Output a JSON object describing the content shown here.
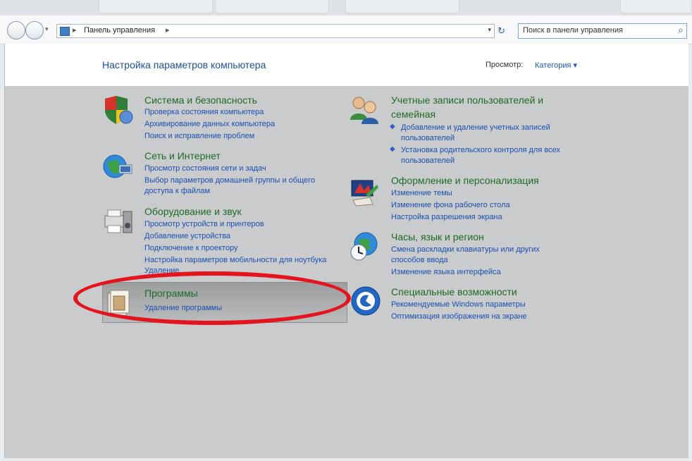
{
  "window": {
    "title": "Панель управления"
  },
  "address": {
    "breadcrumb": "Панель управления",
    "separator": "▸",
    "search_placeholder": "Поиск в панели управления"
  },
  "header": {
    "title": "Настройка параметров компьютера",
    "view_by_label": "Просмотр:",
    "view_by_value": "Категория ▾"
  },
  "categories_left": [
    {
      "title": "Система и безопасность",
      "icon": "shield-flag-icon",
      "links": [
        "Проверка состояния компьютера",
        "Архивирование данных компьютера",
        "Поиск и исправление проблем"
      ]
    },
    {
      "title": "Сеть и Интернет",
      "icon": "globe-network-icon",
      "links": [
        "Просмотр состояния сети и задач",
        "Выбор параметров домашней группы и общего",
        "доступа к файлам"
      ]
    },
    {
      "title": "Оборудование и звук",
      "icon": "printer-speaker-icon",
      "links": [
        "Просмотр устройств и принтеров",
        "Добавление устройства",
        "Подключение к проектору",
        "Настройка параметров мобильности для ноутбука",
        "Удаление"
      ]
    },
    {
      "title": "Программы",
      "icon": "programs-box-icon",
      "links": [
        "Удаление программы"
      ]
    }
  ],
  "categories_right": [
    {
      "title": "Учетные записи пользователей и",
      "title2": "семейная",
      "icon": "users-icon",
      "links": [
        "Добавление и удаление учетных записей",
        "пользователей",
        "Установка родительского контроля для всех",
        "пользователей"
      ]
    },
    {
      "title": "Оформление и персонализация",
      "icon": "paint-display-icon",
      "links": [
        "Изменение темы",
        "Изменение фона рабочего стола",
        "Настройка разрешения экрана"
      ]
    },
    {
      "title": "Часы, язык и регион",
      "icon": "clock-globe-icon",
      "links": [
        "Смена раскладки клавиатуры или других",
        "способов ввода",
        "Изменение языка интерфейса"
      ]
    },
    {
      "title": "Специальные возможности",
      "icon": "accessibility-icon",
      "links": [
        "Рекомендуемые Windows параметры",
        "Оптимизация изображения на экране"
      ]
    }
  ],
  "annotation": {
    "color": "#e3141d"
  }
}
